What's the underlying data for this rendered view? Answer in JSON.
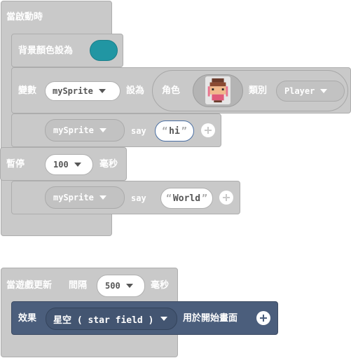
{
  "on_start": {
    "label": "當啟動時"
  },
  "background": {
    "label": "背景顏色設為",
    "color": "#2196a3"
  },
  "set_var": {
    "label": "變數",
    "variable": "mySprite",
    "set_to": "設為",
    "sprite_label": "角色",
    "kind_label": "類別",
    "kind": "Player"
  },
  "say1": {
    "sprite": "mySprite",
    "verb": "say",
    "text": "hi"
  },
  "pause": {
    "label": "暫停",
    "ms": "100",
    "unit": "毫秒"
  },
  "say2": {
    "sprite": "mySprite",
    "verb": "say",
    "text": "World"
  },
  "update": {
    "label": "當遊戲更新",
    "interval_label": "間隔",
    "ms": "500",
    "unit": "毫秒"
  },
  "effect": {
    "label": "效果",
    "value": "星空 ( star field )",
    "suffix": "用於開始畫面"
  },
  "colors": {
    "block": "#c9c9c9",
    "effect_block": "#4b5e7c",
    "dropdown_border": "#b0b0b0",
    "string_border": "#4a6fa3"
  },
  "icons": [
    "caret-down-icon",
    "plus-icon",
    "sprite-thumbnail-icon"
  ]
}
